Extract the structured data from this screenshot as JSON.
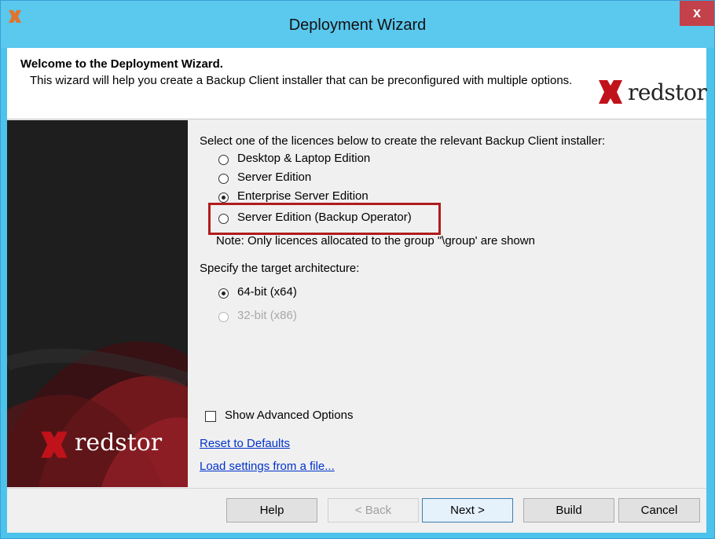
{
  "window": {
    "title": "Deployment Wizard",
    "close_label": "x"
  },
  "header": {
    "title": "Welcome to the Deployment Wizard.",
    "description": "This wizard will help you create a Backup Client installer that can be preconfigured with multiple options.",
    "logo_text": "redstor"
  },
  "side_panel": {
    "logo_text": "redstor"
  },
  "licence": {
    "prompt": "Select one of the licences below to create the relevant Backup Client installer:",
    "options": [
      {
        "label": "Desktop & Laptop Edition",
        "selected": false
      },
      {
        "label": "Server Edition",
        "selected": false
      },
      {
        "label": "Enterprise Server Edition",
        "selected": true
      },
      {
        "label": "Server Edition (Backup Operator)",
        "selected": false,
        "highlighted": true
      }
    ],
    "note": "Note: Only licences allocated to the group \"\\group' are shown"
  },
  "architecture": {
    "prompt": "Specify the target architecture:",
    "options": [
      {
        "label": "64-bit (x64)",
        "selected": true,
        "enabled": true
      },
      {
        "label": "32-bit (x86)",
        "selected": false,
        "enabled": false
      }
    ]
  },
  "advanced": {
    "checkbox_label": "Show Advanced Options",
    "checked": false
  },
  "links": {
    "reset": "Reset to Defaults",
    "load": "Load settings from a file..."
  },
  "buttons": {
    "help": "Help",
    "back": "< Back",
    "next": "Next >",
    "build": "Build",
    "cancel": "Cancel"
  },
  "colors": {
    "titlebar": "#5bc8ee",
    "brand_red": "#c0121a",
    "highlight_border": "#b01c1c",
    "link": "#0033cc"
  }
}
